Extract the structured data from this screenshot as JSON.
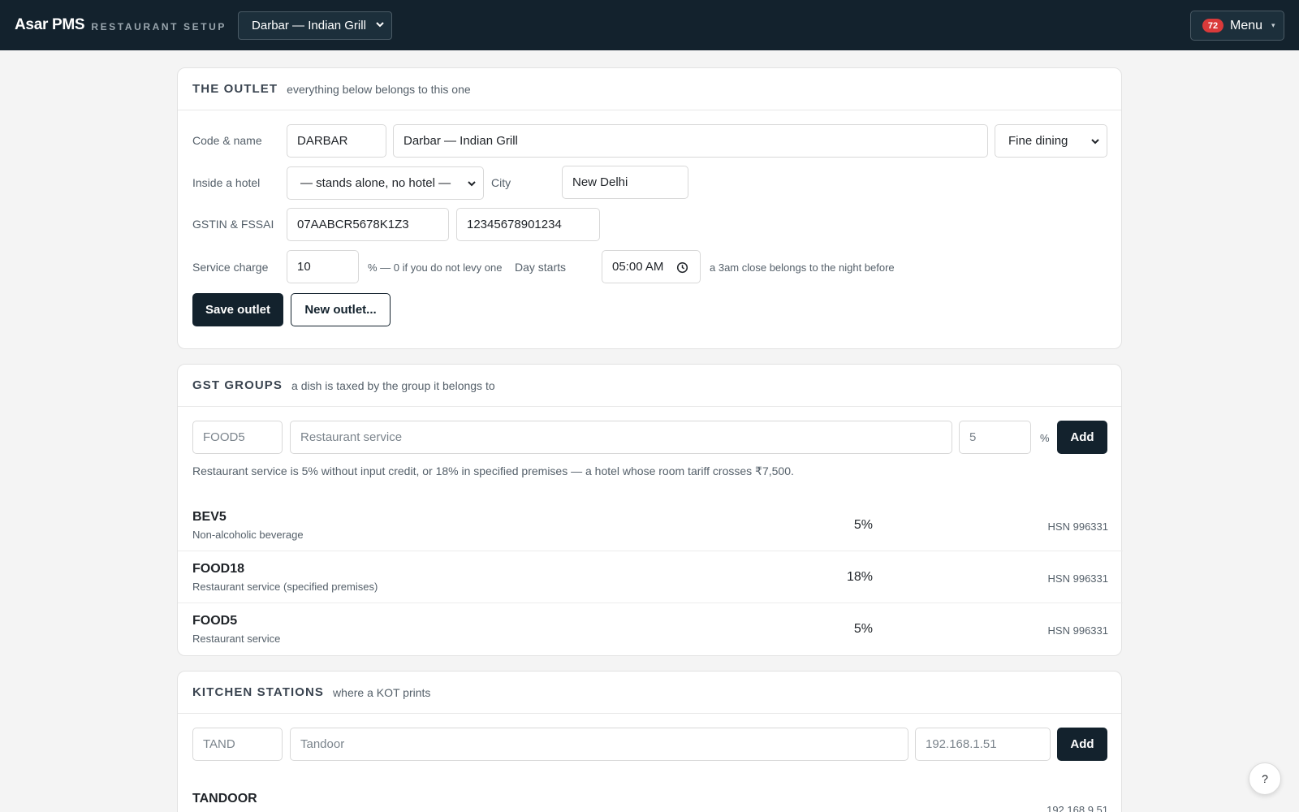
{
  "header": {
    "brand": "Asar PMS",
    "subtitle": "RESTAURANT SETUP",
    "outlet_select": "Darbar — Indian Grill",
    "menu_badge": "72",
    "menu_label": "Menu",
    "menu_caret": "▾"
  },
  "outlet": {
    "title": "THE OUTLET",
    "subtitle": "everything below belongs to this one",
    "code_label": "Code & name",
    "code": "DARBAR",
    "name": "Darbar — Indian Grill",
    "type": "Fine dining",
    "hotel_label": "Inside a hotel",
    "hotel": "— stands alone, no hotel —",
    "city_label": "City",
    "city": "New Delhi",
    "gstin_label": "GSTIN & FSSAI",
    "gstin": "07AABCR5678K1Z3",
    "fssai": "12345678901234",
    "service_label": "Service charge",
    "service": "10",
    "service_hint": "% — 0 if you do not levy one",
    "day_label": "Day starts",
    "day_starts": "05:00 AM",
    "day_hint": "a 3am close belongs to the night before",
    "save_label": "Save outlet",
    "new_label": "New outlet..."
  },
  "gst": {
    "title": "GST GROUPS",
    "subtitle": "a dish is taxed by the group it belongs to",
    "code_placeholder": "FOOD5",
    "name_placeholder": "Restaurant service",
    "rate_placeholder": "5",
    "pct": "%",
    "add_label": "Add",
    "note": "Restaurant service is 5% without input credit, or 18% in specified premises — a hotel whose room tariff crosses ₹7,500.",
    "groups": [
      {
        "code": "BEV5",
        "name": "Non-alcoholic beverage",
        "rate": "5%",
        "hsn": "HSN 996331"
      },
      {
        "code": "FOOD18",
        "name": "Restaurant service (specified premises)",
        "rate": "18%",
        "hsn": "HSN 996331"
      },
      {
        "code": "FOOD5",
        "name": "Restaurant service",
        "rate": "5%",
        "hsn": "HSN 996331"
      }
    ]
  },
  "kitchen": {
    "title": "KITCHEN STATIONS",
    "subtitle": "where a KOT prints",
    "code_placeholder": "TAND",
    "name_placeholder": "Tandoor",
    "ip_placeholder": "192.168.1.51",
    "add_label": "Add",
    "stations": [
      {
        "code": "TANDOOR",
        "ip": "192.168.9.51"
      }
    ]
  },
  "help_label": "?",
  "colors": {
    "topbar": "#13222d",
    "badge": "#d93a3a",
    "primary_button": "#13222d"
  }
}
